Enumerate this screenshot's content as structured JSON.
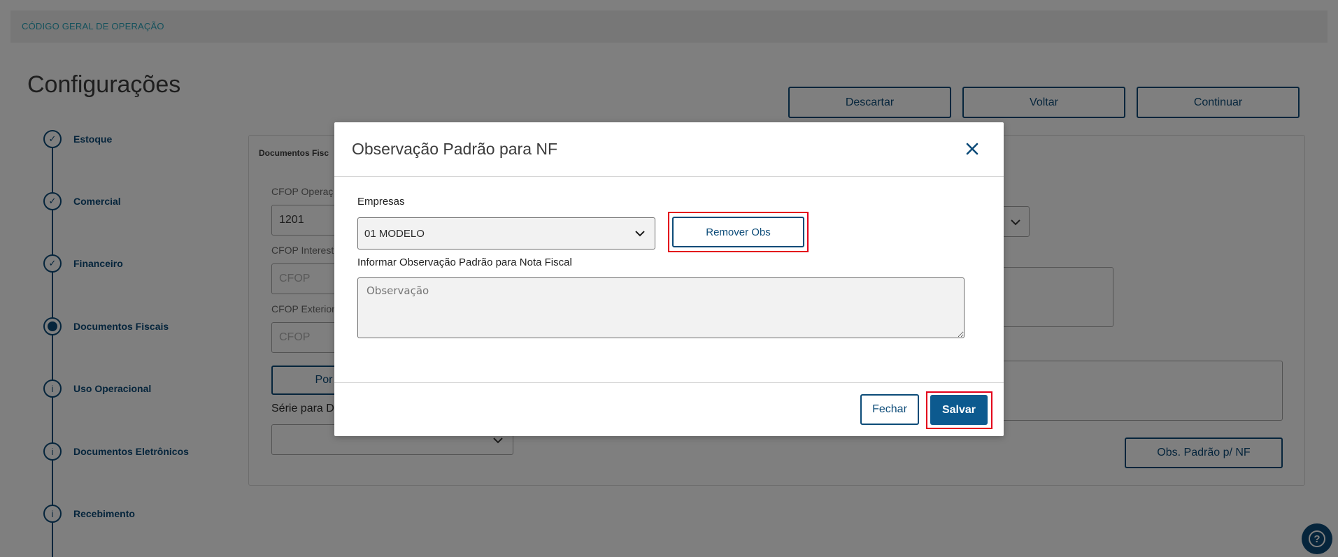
{
  "background": {
    "breadcrumb": "CÓDIGO GERAL DE OPERAÇÃO",
    "page_title": "Configurações",
    "top_buttons": [
      "Descartar",
      "Voltar",
      "Continuar"
    ],
    "steps": [
      {
        "label": "Estoque",
        "state": "done"
      },
      {
        "label": "Comercial",
        "state": "done"
      },
      {
        "label": "Financeiro",
        "state": "done"
      },
      {
        "label": "Documentos Fiscais",
        "state": "active"
      },
      {
        "label": "Uso Operacional",
        "state": "info"
      },
      {
        "label": "Documentos Eletrônicos",
        "state": "info"
      },
      {
        "label": "Recebimento",
        "state": "info"
      }
    ],
    "panel_title": "Documentos Fisc",
    "cfop_operacao_label": "CFOP Operaç",
    "cfop_operacao_value": "1201",
    "cfop_interestadual_label": "CFOP Interest",
    "cfop_interestadual_placeholder": "CFOP",
    "cfop_exterior_label": "CFOP Exterior",
    "cfop_exterior_placeholder": "CFOP",
    "por_button": "Por",
    "serie_label": "Série para D",
    "obs_padrao_button": "Obs. Padrão p/ NF"
  },
  "modal": {
    "title": "Observação Padrão para NF",
    "empresas_label": "Empresas",
    "empresas_value": "01 MODELO",
    "remover_obs_label": "Remover Obs",
    "observacao_label": "Informar Observação Padrão para Nota Fiscal",
    "observacao_placeholder": "Observação",
    "fechar_label": "Fechar",
    "salvar_label": "Salvar"
  },
  "help_icon": "?",
  "colors": {
    "primary": "#0c4b78",
    "highlight": "#e3001b",
    "breadcrumb": "#29a3b8"
  }
}
